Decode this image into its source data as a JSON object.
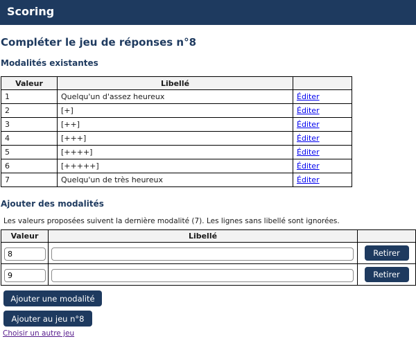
{
  "header": {
    "title": "Scoring"
  },
  "page": {
    "title": "Compléter le jeu de réponses n°8",
    "existing_heading": "Modalités existantes",
    "add_heading": "Ajouter des modalités",
    "note": "Les valeurs proposées suivent la dernière modalité (7). Les lignes sans libellé sont ignorées."
  },
  "existing_table": {
    "headers": [
      "Valeur",
      "Libellé",
      ""
    ],
    "rows": [
      {
        "value": "1",
        "label": "Quelqu'un d'assez heureux",
        "action": "Éditer"
      },
      {
        "value": "2",
        "label": "[+]",
        "action": "Éditer"
      },
      {
        "value": "3",
        "label": "[++]",
        "action": "Éditer"
      },
      {
        "value": "4",
        "label": "[+++]",
        "action": "Éditer"
      },
      {
        "value": "5",
        "label": "[++++]",
        "action": "Éditer"
      },
      {
        "value": "6",
        "label": "[+++++]",
        "action": "Éditer"
      },
      {
        "value": "7",
        "label": "Quelqu'un de très heureux",
        "action": "Éditer"
      }
    ]
  },
  "add_table": {
    "headers": [
      "Valeur",
      "Libellé",
      ""
    ],
    "rows": [
      {
        "value": "8",
        "label": "",
        "button": "Retirer"
      },
      {
        "value": "9",
        "label": "",
        "button": "Retirer"
      }
    ]
  },
  "buttons": {
    "add_modalite": "Ajouter une modalité",
    "add_to_set": "Ajouter au jeu n°8"
  },
  "links": {
    "other_set": "Choisir un autre jeu"
  },
  "colors": {
    "header_bg": "#1e3a5f",
    "heading_text": "#1e3a5f",
    "button_bg": "#1e3a5f",
    "link": "#0000ee",
    "visited_link": "#551a8b"
  }
}
